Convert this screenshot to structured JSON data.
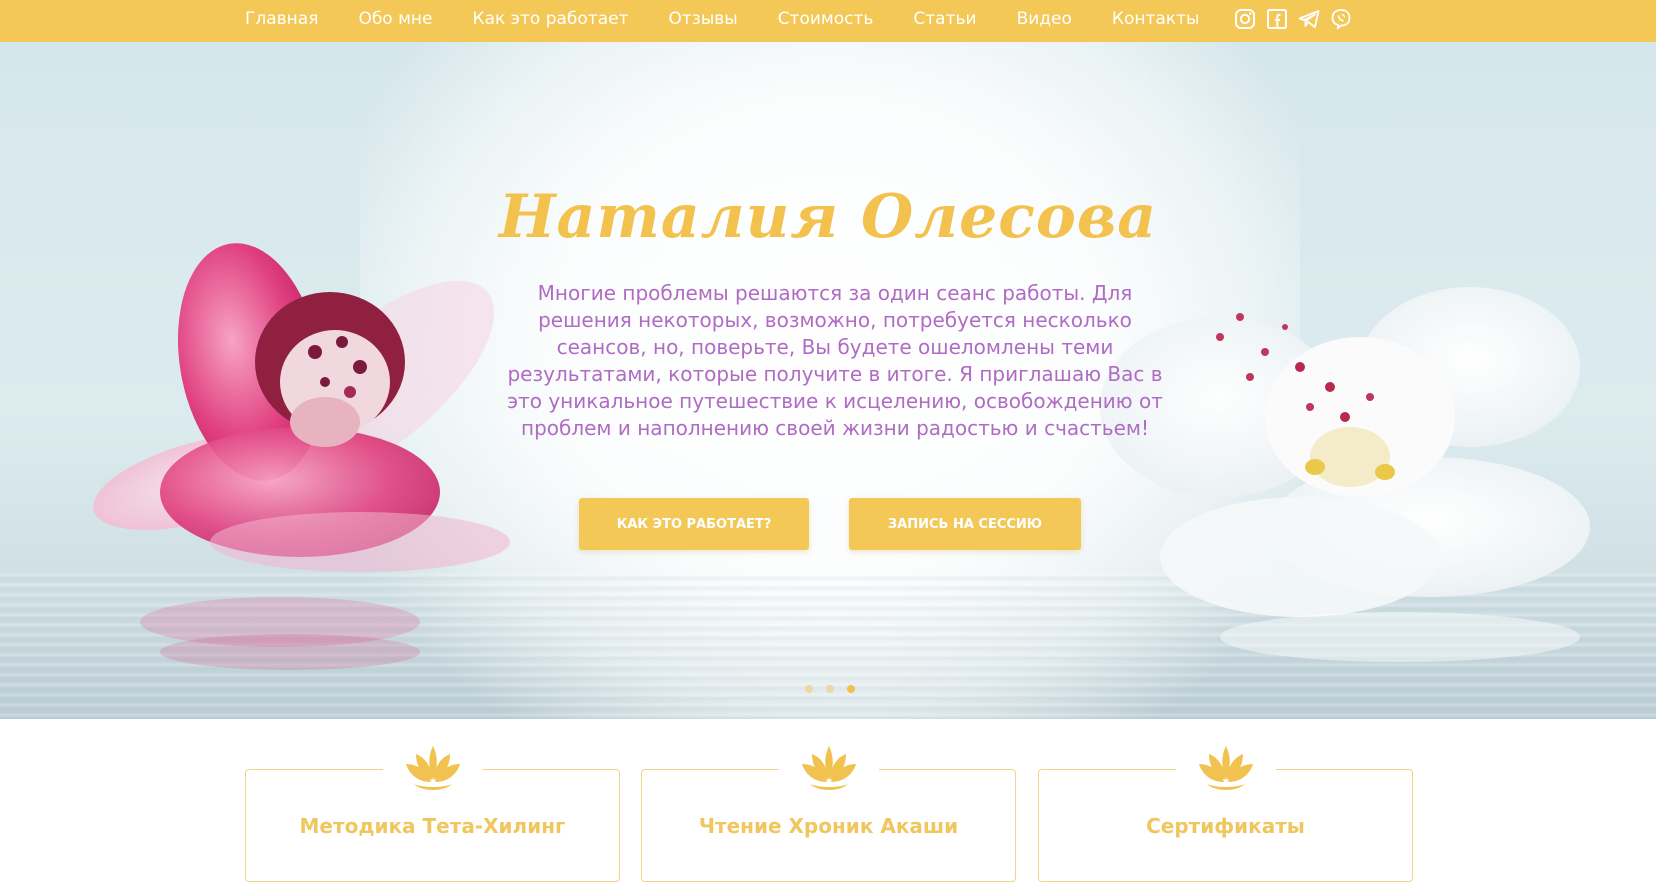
{
  "colors": {
    "accent": "#f3c857",
    "title": "#f2c14e",
    "text_purple": "#b06cc4",
    "card_label": "#f0c65e"
  },
  "nav": {
    "items": [
      {
        "label": "Главная"
      },
      {
        "label": "Обо мне"
      },
      {
        "label": "Как это работает"
      },
      {
        "label": "Отзывы"
      },
      {
        "label": "Стоимость"
      },
      {
        "label": "Статьи"
      },
      {
        "label": "Видео"
      },
      {
        "label": "Контакты"
      }
    ],
    "socials": [
      "instagram-icon",
      "facebook-icon",
      "telegram-icon",
      "viber-icon"
    ]
  },
  "hero": {
    "title": "Наталия Олесова",
    "text": "Многие проблемы решаются за один сеанс работы. Для решения некоторых, возможно, потребуется несколько сеансов, но, поверьте, Вы будете ошеломлены теми результатами, которые получите в итоге. Я приглашаю Вас в это уникальное путешествие к исцелению, освобождению от проблем и наполнению своей жизни радостью и счастьем!",
    "buttons": {
      "how": "КАК ЭТО РАБОТАЕТ?",
      "book": "ЗАПИСЬ НА СЕССИЮ"
    },
    "slider": {
      "count": 3,
      "active": 3
    }
  },
  "cards": [
    {
      "label": "Методика Тета-Хилинг",
      "icon": "lotus-icon"
    },
    {
      "label": "Чтение Хроник Акаши",
      "icon": "lotus-icon"
    },
    {
      "label": "Сертификаты",
      "icon": "lotus-icon"
    }
  ]
}
